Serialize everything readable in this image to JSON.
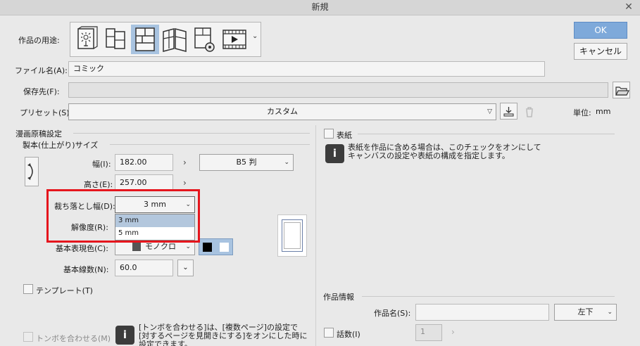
{
  "window": {
    "title": "新規"
  },
  "buttons": {
    "ok": "OK",
    "cancel": "キャンセル"
  },
  "purpose": {
    "label": "作品の用途:",
    "icons": [
      "illustration-icon",
      "webtoon-icon",
      "comic-icon",
      "multipage-icon",
      "print-icon",
      "animation-icon"
    ]
  },
  "filename": {
    "label": "ファイル名(A):",
    "value": "コミック"
  },
  "save_location": {
    "label": "保存先(F):",
    "value": ""
  },
  "preset": {
    "label": "プリセット(S):",
    "value": "カスタム",
    "unit_label": "単位:",
    "unit_value": "mm"
  },
  "manga": {
    "section_title": "漫画原稿設定",
    "size_title": "製本(仕上がり)サイズ",
    "width": {
      "label": "幅(I):",
      "value": "182.00"
    },
    "height": {
      "label": "高さ(E):",
      "value": "257.00"
    },
    "paper": {
      "value": "B5 判"
    },
    "bleed": {
      "label": "裁ち落とし幅(D):",
      "value": "3 mm",
      "options": [
        "3 mm",
        "5 mm"
      ]
    },
    "resolution": {
      "label": "解像度(R):"
    },
    "color_mode": {
      "label": "基本表現色(C):",
      "value": "モノクロ"
    },
    "lines": {
      "label": "基本線数(N):",
      "value": "60.0"
    },
    "template": {
      "label": "テンプレート(T)"
    },
    "crop_marks": {
      "label": "トンボを合わせる(M)",
      "info_line1": "[トンボを合わせる]は、[複数ページ]の設定で",
      "info_line2": "[対するページを見開きにする]をオンにした時に",
      "info_line3": "設定できます。"
    }
  },
  "cover": {
    "label": "表紙",
    "info_line1": "表紙を作品に含める場合は、このチェックをオンにして",
    "info_line2": "キャンバスの設定や表紙の構成を指定します。"
  },
  "work_info": {
    "section_title": "作品情報",
    "name": {
      "label": "作品名(S):",
      "value": ""
    },
    "position": {
      "value": "左下"
    },
    "count": {
      "label": "話数(I)",
      "value": "1"
    }
  },
  "colors": {
    "accent": "#7ea9da",
    "highlight": "#e5151d"
  }
}
